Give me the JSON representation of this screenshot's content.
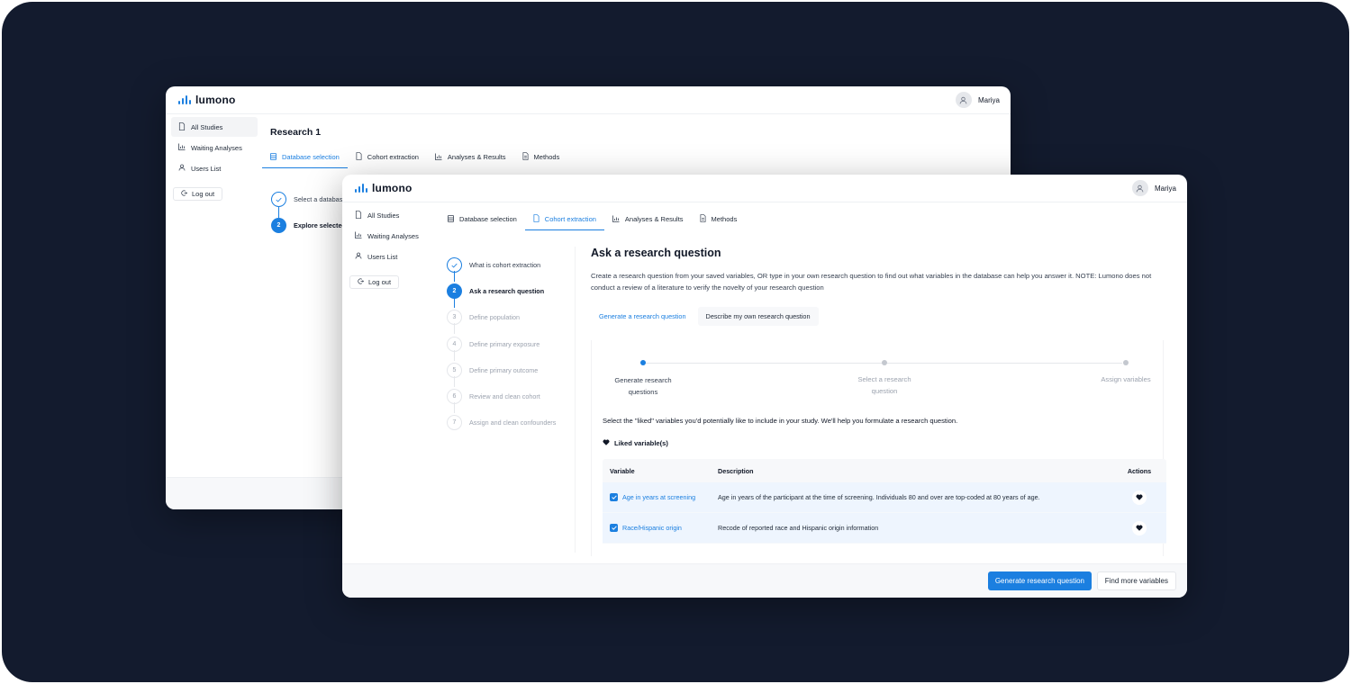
{
  "brand": {
    "name": "lumono",
    "accent": "#1b7fe0",
    "backdrop": "#131b2e"
  },
  "user": {
    "name": "Mariya",
    "icon": "user-icon"
  },
  "sidebar": {
    "items": [
      {
        "label": "All Studies",
        "icon": "file-icon"
      },
      {
        "label": "Waiting Analyses",
        "icon": "bar-chart-icon"
      },
      {
        "label": "Users List",
        "icon": "user-icon"
      }
    ],
    "logout_label": "Log out"
  },
  "tabs": [
    {
      "label": "Database selection",
      "icon": "database-icon"
    },
    {
      "label": "Cohort extraction",
      "icon": "file-icon"
    },
    {
      "label": "Analyses & Results",
      "icon": "bar-chart-icon"
    },
    {
      "label": "Methods",
      "icon": "document-icon"
    }
  ],
  "back_window": {
    "title": "Research 1",
    "active_tab": "Database selection",
    "steps": [
      {
        "label": "Select a databas",
        "state": "done"
      },
      {
        "label": "Explore selected",
        "number": "2",
        "state": "current"
      }
    ]
  },
  "front_window": {
    "active_tab": "Cohort extraction",
    "steps": [
      {
        "number": "1",
        "label": "What is cohort extraction",
        "state": "done"
      },
      {
        "number": "2",
        "label": "Ask a research question",
        "state": "current"
      },
      {
        "number": "3",
        "label": "Define population",
        "state": "todo"
      },
      {
        "number": "4",
        "label": "Define primary exposure",
        "state": "todo"
      },
      {
        "number": "5",
        "label": "Define primary outcome",
        "state": "todo"
      },
      {
        "number": "6",
        "label": "Review and clean cohort",
        "state": "todo"
      },
      {
        "number": "7",
        "label": "Assign and clean confounders",
        "state": "todo"
      }
    ],
    "heading": "Ask a research question",
    "description": "Create a research question from your saved variables, OR type in your own research question to find out what variables in the database can help you answer it. NOTE: Lumono does not conduct a review of a literature to verify the novelty of your research question",
    "subtabs": [
      {
        "label": "Generate a research question",
        "active": true
      },
      {
        "label": "Describe my own research question",
        "active": false
      }
    ],
    "progress": {
      "current_step": 1,
      "steps": [
        {
          "label": "Generate research questions",
          "line1": "Generate research",
          "line2": "questions"
        },
        {
          "label": "Select a research question",
          "line1": "Select a research",
          "line2": "question"
        },
        {
          "label": "Assign variables",
          "line1": "Assign variables",
          "line2": ""
        }
      ]
    },
    "instruction": "Select the \"liked\" variables you'd potentially like to include in your study. We'll help you formulate a research question.",
    "liked_label": "Liked variable(s)",
    "table": {
      "columns": [
        "Variable",
        "Description",
        "Actions"
      ],
      "rows": [
        {
          "variable": "Age in years at screening",
          "description": "Age in years of the participant at the time of screening. Individuals 80 and over are top-coded at 80 years of age.",
          "checked": true
        },
        {
          "variable": "Race/Hispanic origin",
          "description": "Recode of reported race and Hispanic origin information",
          "checked": true
        }
      ]
    },
    "buttons": {
      "primary": "Generate research question",
      "secondary": "Find more variables"
    }
  }
}
